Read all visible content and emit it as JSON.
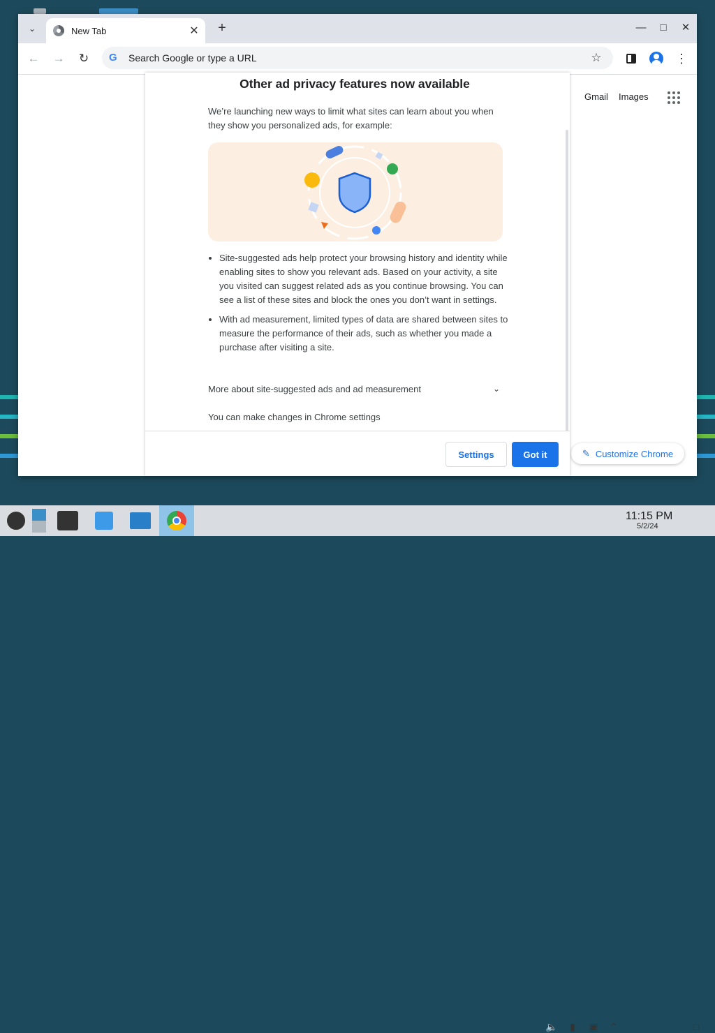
{
  "browser": {
    "tab_title": "New Tab",
    "omnibox_placeholder": "Search Google or type a URL"
  },
  "ntp": {
    "gmail": "Gmail",
    "images": "Images",
    "customize": "Customize Chrome"
  },
  "dialog": {
    "title": "Other ad privacy features now available",
    "intro": "We’re launching new ways to limit what sites can learn about you when they show you personalized ads, for example:",
    "bullets": [
      "Site-suggested ads help protect your browsing history and identity while enabling sites to show you relevant ads. Based on your activity, a site you visited can suggest related ads as you continue browsing. You can see a list of these sites and block the ones you don’t want in settings.",
      "With ad measurement, limited types of data are shared between sites to measure the performance of their ads, such as whether you made a purchase after visiting a site."
    ],
    "more_link": "More about site-suggested ads and ad measurement",
    "changes_text": "You can make changes in Chrome settings",
    "settings_button": "Settings",
    "gotit_button": "Got it"
  },
  "taskbar": {
    "time": "11:15 PM",
    "date": "5/2/24"
  },
  "colors": {
    "accent": "#1a73e8",
    "desktop": "#1c4a5c",
    "taskbar": "#d9dde1",
    "illustration_bg": "#fdeee2"
  }
}
